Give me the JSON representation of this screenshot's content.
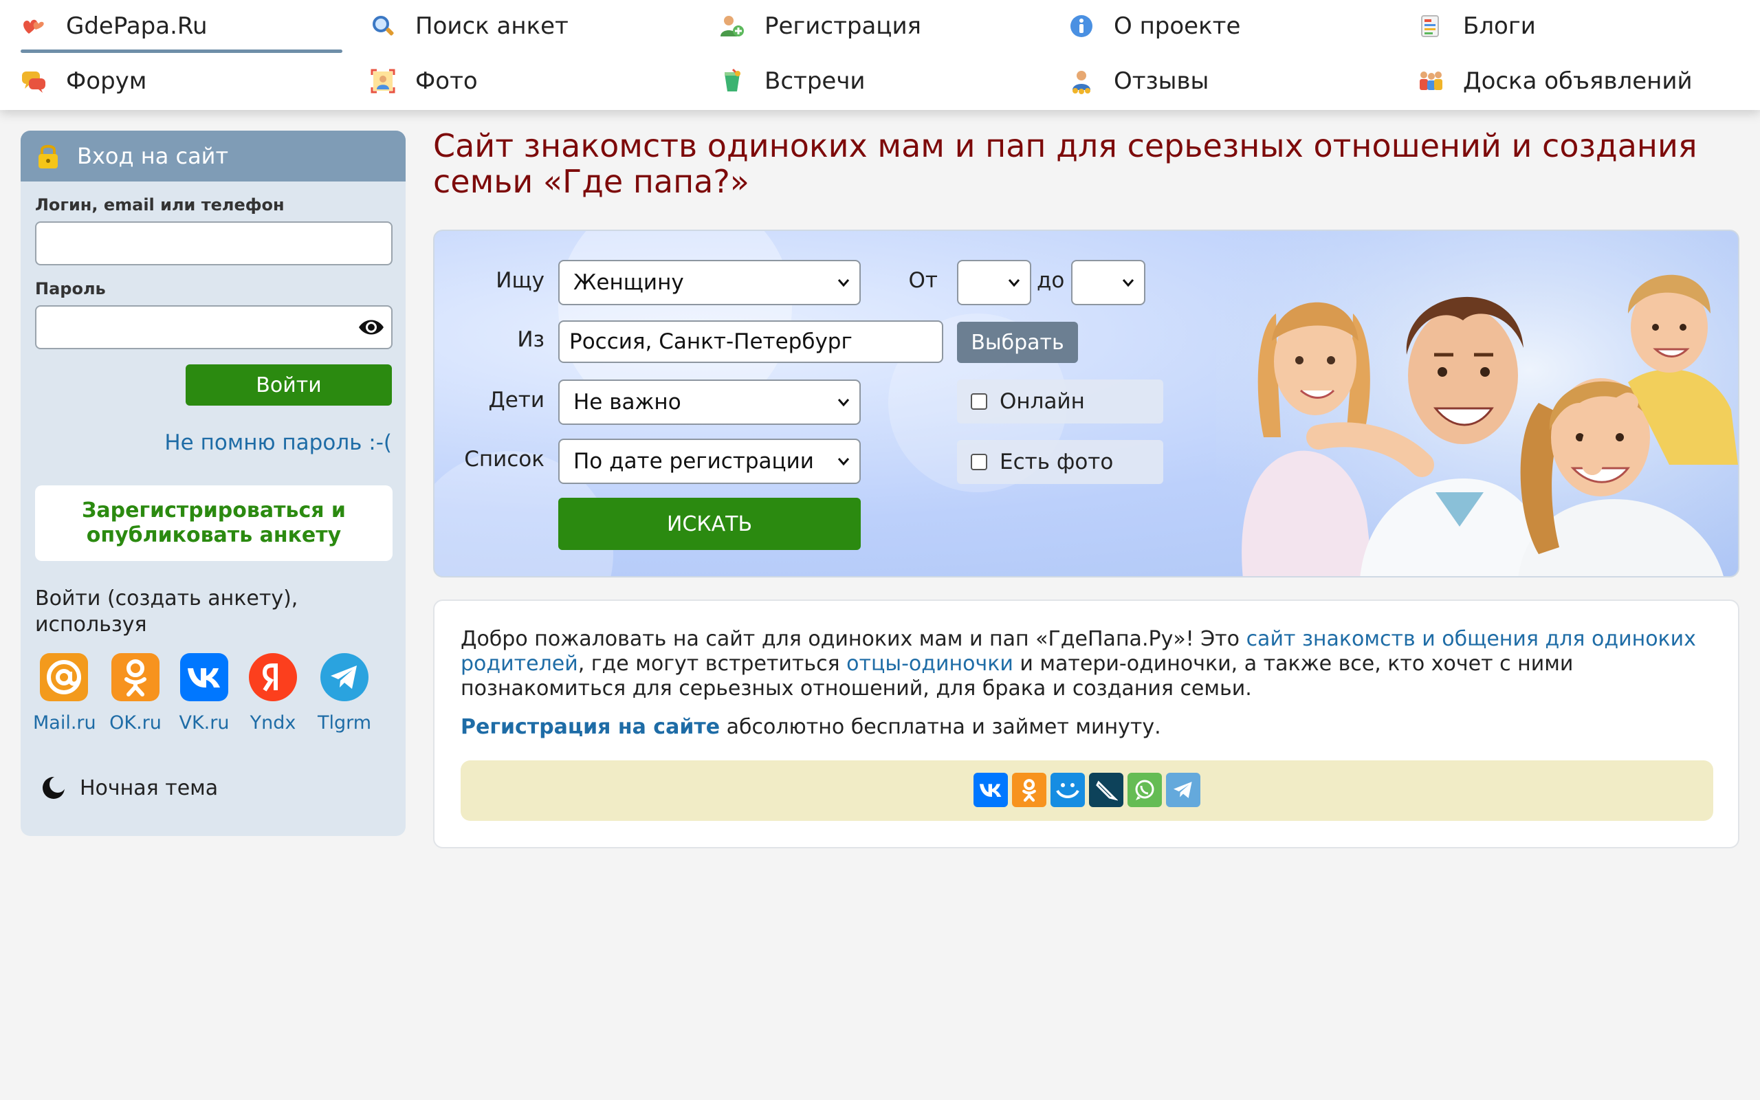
{
  "nav": {
    "items": [
      {
        "label": "GdePapa.Ru",
        "icon": "hearts-icon"
      },
      {
        "label": "Поиск анкет",
        "icon": "magnifier-icon"
      },
      {
        "label": "Регистрация",
        "icon": "add-user-icon"
      },
      {
        "label": "О проекте",
        "icon": "info-icon"
      },
      {
        "label": "Блоги",
        "icon": "blog-icon"
      },
      {
        "label": "Форум",
        "icon": "chat-bubbles-icon"
      },
      {
        "label": "Фото",
        "icon": "photo-icon"
      },
      {
        "label": "Встречи",
        "icon": "cocktail-icon"
      },
      {
        "label": "Отзывы",
        "icon": "review-person-icon"
      },
      {
        "label": "Доска объявлений",
        "icon": "people-board-icon"
      }
    ]
  },
  "sidebar": {
    "title": "Вход на сайт",
    "login_label": "Логин, email или телефон",
    "login_value": "",
    "password_label": "Пароль",
    "password_value": "",
    "login_button": "Войти",
    "forgot_link": "Не помню пароль :-(",
    "register_button": "Зарегистрироваться и опубликовать анкету",
    "social_intro": "Войти (создать анкету), используя",
    "social": [
      {
        "label": "Mail.ru",
        "color": "#f39a1c"
      },
      {
        "label": "OK.ru",
        "color": "#f7931e"
      },
      {
        "label": "VK.ru",
        "color": "#0077ff"
      },
      {
        "label": "Yndx",
        "color": "#fc3f1d"
      },
      {
        "label": "Tlgrm",
        "color": "#2aa3df"
      }
    ],
    "night_theme": "Ночная тема"
  },
  "main": {
    "title": "Сайт знакомств одиноких мам и пап для серьезных отношений и создания семьи «Где папа?»"
  },
  "search": {
    "seek_label": "Ищу",
    "seek_value": "Женщину",
    "from_label": "От",
    "from_value": "",
    "to_label": "до",
    "to_value": "",
    "city_label": "Из",
    "city_value": "Россия, Санкт-Петербург",
    "pick_button": "Выбрать",
    "kids_label": "Дети",
    "kids_value": "Не важно",
    "online_label": "Онлайн",
    "list_label": "Список",
    "list_value": "По дате регистрации",
    "photo_label": "Есть фото",
    "search_button": "ИСКАТЬ"
  },
  "welcome": {
    "text_1": "Добро пожаловать на сайт для одиноких мам и пап «ГдеПапа.Ру»! Это ",
    "link_1": "сайт знакомств и общения для одиноких родителей",
    "text_2": ", где могут встретиться ",
    "link_2": "отцы-одиночки",
    "text_3": " и матери-одиночки, а также все, кто хочет с ними познакомиться для серьезных отношений, для брака и создания семьи.",
    "reg_link": "Регистрация на сайте",
    "reg_text": " абсолютно бесплатна и займет минуту.",
    "share": [
      {
        "name": "vk",
        "color": "#0077ff"
      },
      {
        "name": "ok",
        "color": "#f7931e"
      },
      {
        "name": "mail",
        "color": "#168de2"
      },
      {
        "name": "livejournal",
        "color": "#0d425a"
      },
      {
        "name": "whatsapp",
        "color": "#65bc54"
      },
      {
        "name": "telegram",
        "color": "#64a9dc"
      }
    ]
  }
}
